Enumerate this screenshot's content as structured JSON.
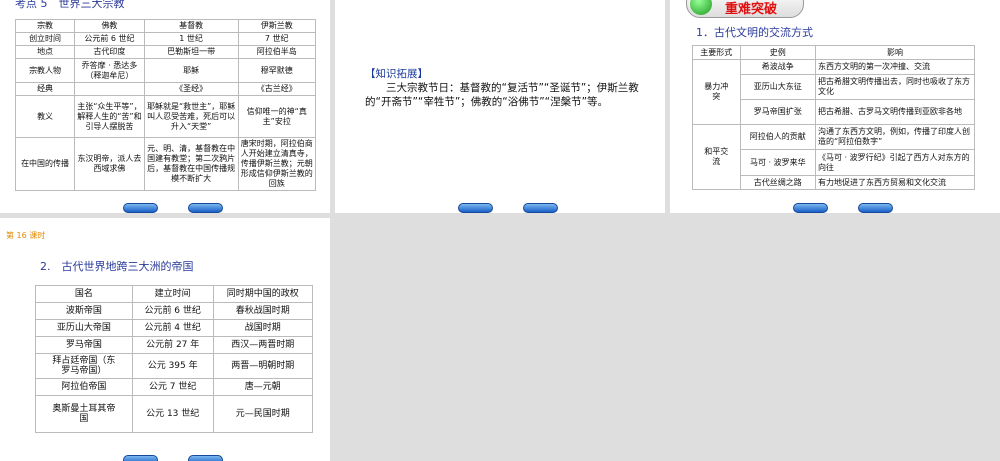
{
  "slide1": {
    "title": "考点 5　世界三大宗教",
    "rows": [
      [
        "宗教",
        "佛教",
        "基督教",
        "伊斯兰教"
      ],
      [
        "创立时间",
        "公元前 6 世纪",
        "1 世纪",
        "7 世纪"
      ],
      [
        "地点",
        "古代印度",
        "巴勒斯坦一带",
        "阿拉伯半岛"
      ],
      [
        "宗教人物",
        "乔答摩 · 悉达多（释迦牟尼）",
        "耶稣",
        "穆罕默德"
      ],
      [
        "经典",
        "",
        "《圣经》",
        "《古兰经》"
      ],
      [
        "教义",
        "主张“众生平等”，解释人生的“苦”和引导人摆脱苦",
        "耶稣就是“救世主”，耶稣叫人忍受苦难，死后可以升入“天堂”",
        "信仰唯一的神“真主”安拉"
      ],
      [
        "在中国的传播",
        "东汉明帝，派人去西域求佛",
        "元、明、清，基督教在中国建有教堂；第二次鸦片后，基督教在中国传播规模不断扩大",
        "唐宋时期，阿拉伯商人开始建立清真寺，传播伊斯兰教；元朝形成信仰伊斯兰教的回族"
      ]
    ]
  },
  "slide2": {
    "heading": "【知识拓展】",
    "body": "三大宗教节日：基督教的“复活节”“圣诞节”；伊斯兰教的“开斋节”“宰牲节”；佛教的“浴佛节”“涅槃节”等。"
  },
  "slide3": {
    "badge": "重难突破",
    "title": "1．古代文明的交流方式",
    "header": [
      "主要形式",
      "史例",
      "影响"
    ],
    "groups": [
      {
        "form": "暴力冲突",
        "rows": [
          [
            "希波战争",
            "东西方文明的第一次冲撞、交流"
          ],
          [
            "亚历山大东征",
            "把古希腊文明传播出去，同时也吸收了东方文化"
          ],
          [
            "罗马帝国扩张",
            "把古希腊、古罗马文明传播到亚欧非各地"
          ]
        ]
      },
      {
        "form": "和平交流",
        "rows": [
          [
            "阿拉伯人的贡献",
            "沟通了东西方文明，例如，传播了印度人创造的“阿拉伯数字”"
          ],
          [
            "马可 · 波罗来华",
            "《马可 · 波罗行纪》引起了西方人对东方的向往"
          ],
          [
            "古代丝绸之路",
            "有力地促进了东西方贸易和文化交流"
          ]
        ]
      }
    ]
  },
  "slide4": {
    "lesson": "第 16 课时",
    "title": "2.　古代世界地跨三大洲的帝国",
    "rows": [
      [
        "国名",
        "建立时间",
        "同时期中国的政权"
      ],
      [
        "波斯帝国",
        "公元前 6 世纪",
        "春秋战国时期"
      ],
      [
        "亚历山大帝国",
        "公元前 4 世纪",
        "战国时期"
      ],
      [
        "罗马帝国",
        "公元前 27 年",
        "西汉—两晋时期"
      ],
      [
        "拜占廷帝国（东罗马帝国）",
        "公元 395 年",
        "两晋—明朝时期"
      ],
      [
        "阿拉伯帝国",
        "公元 7 世纪",
        "唐—元朝"
      ],
      [
        "奥斯曼土耳其帝国",
        "公元 13 世纪",
        "元—民国时期"
      ]
    ]
  }
}
